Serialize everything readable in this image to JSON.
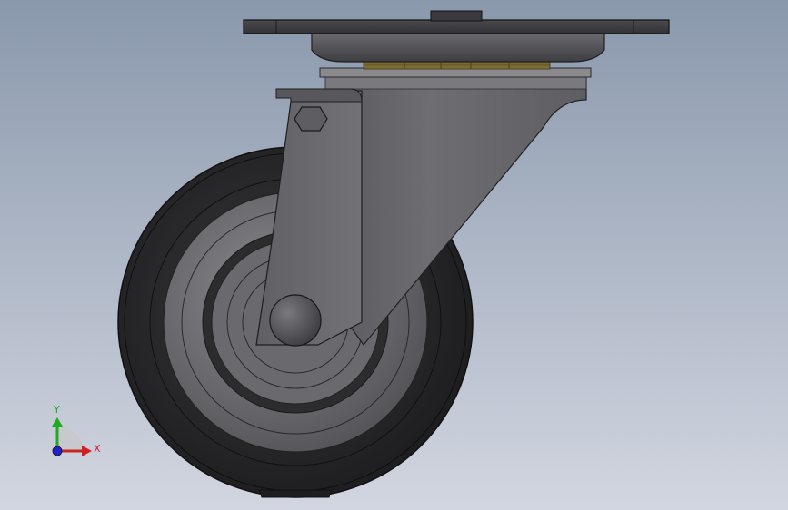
{
  "viewport": {
    "background_top": "#8a98ac",
    "background_bottom": "#d2d6e0"
  },
  "model": {
    "part": "swivel-caster",
    "colors": {
      "tire": "#2a2a2c",
      "tire_edge": "#1a1a1a",
      "hub": "#6c6c70",
      "bracket_light": "#6e6e72",
      "bracket_dark": "#4a4a4e",
      "plate": "#3c3c40",
      "bearing": "#8a7a3a"
    }
  },
  "triad": {
    "x_label": "X",
    "y_label": "Y",
    "x_color": "#cc2222",
    "y_color": "#22aa22",
    "z_color": "#2222cc"
  }
}
